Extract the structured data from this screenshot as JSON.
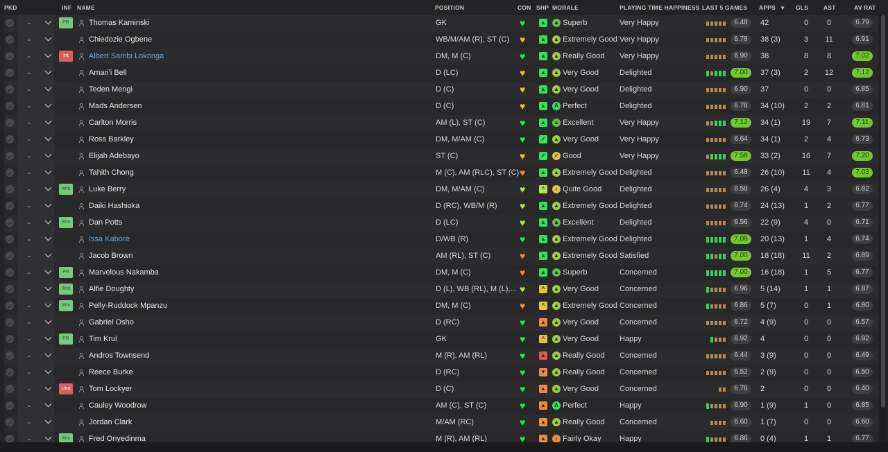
{
  "header": {
    "pkd": "PKD",
    "inf": "INF",
    "name": "NAME",
    "position": "POSITION",
    "con": "CON",
    "shp": "SHP",
    "morale": "MORALE",
    "playing_time_happiness": "PLAYING TIME HAPPINESS",
    "last5": "LAST 5 GAMES",
    "apps": "APPS",
    "apps_sort": "▾",
    "gls": "GLS",
    "ast": "AST",
    "avrat": "AV RAT"
  },
  "colors": {
    "green": "#2ce55b",
    "lime": "#b0e54a",
    "amber": "#e8c13c",
    "orange": "#f08b3b",
    "red": "#e05656",
    "form_green": "#32d45e",
    "form_olive": "#c8b25a",
    "form_tan": "#b58c55"
  },
  "players": [
    {
      "sel": "-",
      "inf": "PR",
      "name": "Thomas Kaminski",
      "link": false,
      "pos": "GK",
      "con": "#2ce55b",
      "shp": "green",
      "shp_sym": "▲",
      "mor_sym": "▲",
      "mor_col": "#5fc04a",
      "morale": "Superb",
      "pth": "Very Happy",
      "form": [
        "t",
        "t",
        "t",
        "t",
        "t"
      ],
      "last": "6.48",
      "last_hi": false,
      "apps": "42",
      "gls": "0",
      "ast": "0",
      "av": "6.79",
      "av_hi": false
    },
    {
      "sel": "-",
      "inf": "",
      "name": "Chiedozie Ogbene",
      "link": false,
      "pos": "WB/M/AM (R), ST (C)",
      "con": "#e8c13c",
      "shp": "green",
      "shp_sym": "▲",
      "mor_sym": "▲",
      "mor_col": "#9ccf3b",
      "morale": "Extremely Good",
      "pth": "Very Happy",
      "form": [
        "t",
        "t",
        "t",
        "t",
        "t"
      ],
      "last": "6.78",
      "last_hi": false,
      "apps": "38 (3)",
      "gls": "3",
      "ast": "11",
      "av": "6.91",
      "av_hi": false
    },
    {
      "sel": "-",
      "inf": "Int",
      "name": "Albert Sambi Lokonga",
      "link": true,
      "pos": "DM, M (C)",
      "con": "#2ce55b",
      "shp": "green",
      "shp_sym": "▲",
      "mor_sym": "▲",
      "mor_col": "#9ccf3b",
      "morale": "Really Good",
      "pth": "Very Happy",
      "form": [
        "t",
        "t",
        "t",
        "t",
        "t"
      ],
      "last": "6.90",
      "last_hi": false,
      "apps": "38",
      "gls": "8",
      "ast": "8",
      "av": "7.02",
      "av_hi": true
    },
    {
      "sel": "-",
      "inf": "",
      "name": "Amari'i Bell",
      "link": false,
      "pos": "D (LC)",
      "con": "#e8c13c",
      "shp": "green",
      "shp_sym": "▲",
      "mor_sym": "▲",
      "mor_col": "#9ccf3b",
      "morale": "Very Good",
      "pth": "Delighted",
      "form": [
        "g",
        "t",
        "g",
        "g",
        "g"
      ],
      "last": "7.00",
      "last_hi": true,
      "apps": "37 (3)",
      "gls": "2",
      "ast": "12",
      "av": "7.12",
      "av_hi": true
    },
    {
      "sel": "-",
      "inf": "",
      "name": "Teden Mengi",
      "link": false,
      "pos": "D (C)",
      "con": "#e8c13c",
      "shp": "green",
      "shp_sym": "▲",
      "mor_sym": "▲",
      "mor_col": "#9ccf3b",
      "morale": "Very Good",
      "pth": "Delighted",
      "form": [
        "t",
        "t",
        "t",
        "t",
        "t"
      ],
      "last": "6.90",
      "last_hi": false,
      "apps": "37",
      "gls": "0",
      "ast": "0",
      "av": "6.85",
      "av_hi": false
    },
    {
      "sel": "-",
      "inf": "",
      "name": "Mads Andersen",
      "link": false,
      "pos": "D (C)",
      "con": "#e8c13c",
      "shp": "green",
      "shp_sym": "▲",
      "mor_sym": "A",
      "mor_col": "#2ce55b",
      "morale": "Perfect",
      "pth": "Delighted",
      "form": [
        "t",
        "t",
        "t",
        "t",
        "t"
      ],
      "last": "6.78",
      "last_hi": false,
      "apps": "34 (10)",
      "gls": "2",
      "ast": "2",
      "av": "6.81",
      "av_hi": false
    },
    {
      "sel": "-",
      "inf": "",
      "name": "Carlton Morris",
      "link": false,
      "pos": "AM (L), ST (C)",
      "con": "#2ce55b",
      "shp": "green",
      "shp_sym": "▲",
      "mor_sym": "▲",
      "mor_col": "#5fc04a",
      "morale": "Excellent",
      "pth": "Very Happy",
      "form": [
        "t",
        "t",
        "g",
        "g",
        "g"
      ],
      "last": "7.12",
      "last_hi": true,
      "apps": "34 (1)",
      "gls": "19",
      "ast": "7",
      "av": "7.11",
      "av_hi": true
    },
    {
      "sel": "-",
      "inf": "",
      "name": "Ross Barkley",
      "link": false,
      "pos": "DM, M/AM (C)",
      "con": "#2ce55b",
      "shp": "green",
      "shp_sym": "✓",
      "mor_sym": "▲",
      "mor_col": "#9ccf3b",
      "morale": "Very Good",
      "pth": "Very Happy",
      "form": [
        "t",
        "t",
        "t",
        "t",
        "t"
      ],
      "last": "6.64",
      "last_hi": false,
      "apps": "34 (1)",
      "gls": "2",
      "ast": "4",
      "av": "6.73",
      "av_hi": false
    },
    {
      "sel": "-",
      "inf": "",
      "name": "Elijah Adebayo",
      "link": false,
      "pos": "ST (C)",
      "con": "#e8c13c",
      "shp": "green",
      "shp_sym": "✓",
      "mor_sym": "✓",
      "mor_col": "#e8c13c",
      "morale": "Good",
      "pth": "Very Happy",
      "form": [
        "t",
        "g",
        "g",
        "g",
        "g"
      ],
      "last": "7.58",
      "last_hi": true,
      "apps": "33 (2)",
      "gls": "16",
      "ast": "7",
      "av": "7.20",
      "av_hi": true
    },
    {
      "sel": "-",
      "inf": "",
      "name": "Tahith Chong",
      "link": false,
      "pos": "M (C), AM (RLC), ST (C)",
      "con": "#f08b3b",
      "shp": "green",
      "shp_sym": "▲",
      "mor_sym": "▲",
      "mor_col": "#9ccf3b",
      "morale": "Extremely Good",
      "pth": "Delighted",
      "form": [
        "t",
        "t",
        "t",
        "t",
        "t"
      ],
      "last": "6.48",
      "last_hi": false,
      "apps": "26 (10)",
      "gls": "11",
      "ast": "4",
      "av": "7.03",
      "av_hi": true
    },
    {
      "sel": "-",
      "inf": "Wnt",
      "name": "Luke Berry",
      "link": false,
      "pos": "DM, M/AM (C)",
      "con": "#b0e54a",
      "shp": "lime",
      "shp_sym": "^",
      "mor_sym": "›",
      "mor_col": "#e8c13c",
      "morale": "Quite Good",
      "pth": "Delighted",
      "form": [
        "t",
        "t",
        "t",
        "t",
        "t"
      ],
      "last": "6.56",
      "last_hi": false,
      "apps": "26 (4)",
      "gls": "4",
      "ast": "3",
      "av": "6.82",
      "av_hi": false
    },
    {
      "sel": "-",
      "inf": "",
      "name": "Daiki Hashioka",
      "link": false,
      "pos": "D (RC), WB/M (R)",
      "con": "#b0e54a",
      "shp": "green",
      "shp_sym": "▲",
      "mor_sym": "▲",
      "mor_col": "#9ccf3b",
      "morale": "Extremely Good",
      "pth": "Delighted",
      "form": [
        "t",
        "t",
        "t",
        "t",
        "t"
      ],
      "last": "6.74",
      "last_hi": false,
      "apps": "24 (13)",
      "gls": "1",
      "ast": "2",
      "av": "6.77",
      "av_hi": false
    },
    {
      "sel": "-",
      "inf": "Wnt",
      "name": "Dan Potts",
      "link": false,
      "pos": "D (LC)",
      "con": "#b0e54a",
      "shp": "green",
      "shp_sym": "▲",
      "mor_sym": "▲",
      "mor_col": "#5fc04a",
      "morale": "Excellent",
      "pth": "Delighted",
      "form": [
        "t",
        "t",
        "t",
        "t",
        "t"
      ],
      "last": "6.56",
      "last_hi": false,
      "apps": "22 (9)",
      "gls": "4",
      "ast": "0",
      "av": "6.71",
      "av_hi": false
    },
    {
      "sel": "-",
      "inf": "",
      "name": "Issa Kaboré",
      "link": true,
      "pos": "D/WB (R)",
      "con": "#2ce55b",
      "shp": "green",
      "shp_sym": "▲",
      "mor_sym": "▲",
      "mor_col": "#9ccf3b",
      "morale": "Extremely Good",
      "pth": "Delighted",
      "form": [
        "g",
        "g",
        "g",
        "g",
        "g"
      ],
      "last": "7.06",
      "last_hi": true,
      "apps": "20 (13)",
      "gls": "1",
      "ast": "4",
      "av": "6.74",
      "av_hi": false
    },
    {
      "sel": "-",
      "inf": "",
      "name": "Jacob Brown",
      "link": false,
      "pos": "AM (RL), ST (C)",
      "con": "#f08b3b",
      "shp": "green",
      "shp_sym": "▲",
      "mor_sym": "▲",
      "mor_col": "#9ccf3b",
      "morale": "Extremely Good",
      "pth": "Satisfied",
      "form": [
        "g",
        "g",
        "t",
        "g",
        "g"
      ],
      "last": "7.00",
      "last_hi": true,
      "apps": "18 (18)",
      "gls": "11",
      "ast": "2",
      "av": "6.89",
      "av_hi": false
    },
    {
      "sel": "-",
      "inf": "PR",
      "name": "Marvelous Nakamba",
      "link": false,
      "pos": "DM, M (C)",
      "con": "#f08b3b",
      "shp": "green",
      "shp_sym": "▲",
      "mor_sym": "▲",
      "mor_col": "#5fc04a",
      "morale": "Superb",
      "pth": "Concerned",
      "form": [
        "g",
        "g",
        "g",
        "g",
        "g"
      ],
      "last": "7.00",
      "last_hi": true,
      "apps": "16 (18)",
      "gls": "1",
      "ast": "5",
      "av": "6.77",
      "av_hi": false
    },
    {
      "sel": "-",
      "inf": "Wnt",
      "name": "Alfie Doughty",
      "link": false,
      "pos": "D (L), WB (RL), M (L),...",
      "con": "#b0e54a",
      "shp": "amber",
      "shp_sym": "^",
      "mor_sym": "▲",
      "mor_col": "#9ccf3b",
      "morale": "Very Good",
      "pth": "Concerned",
      "form": [
        "g",
        "t",
        "t",
        "t",
        "t"
      ],
      "last": "6.96",
      "last_hi": false,
      "apps": "5 (14)",
      "gls": "1",
      "ast": "1",
      "av": "6.87",
      "av_hi": false
    },
    {
      "sel": "-",
      "inf": "Wnt",
      "name": "Pelly-Ruddock Mpanzu",
      "link": false,
      "pos": "DM, M (C)",
      "con": "#f08b3b",
      "shp": "amber",
      "shp_sym": "^",
      "mor_sym": "▲",
      "mor_col": "#9ccf3b",
      "morale": "Extremely Good",
      "pth": "Concerned",
      "form": [
        "g",
        "t",
        "t",
        "t",
        "t"
      ],
      "last": "6.86",
      "last_hi": false,
      "apps": "5 (7)",
      "gls": "0",
      "ast": "1",
      "av": "6.80",
      "av_hi": false
    },
    {
      "sel": "-",
      "inf": "",
      "name": "Gabriel Osho",
      "link": false,
      "pos": "D (RC)",
      "con": "#2ce55b",
      "shp": "orange",
      "shp_sym": "▲",
      "mor_sym": "▲",
      "mor_col": "#9ccf3b",
      "morale": "Very Good",
      "pth": "Concerned",
      "form": [
        "t",
        "t",
        "t",
        "t",
        "t"
      ],
      "last": "6.72",
      "last_hi": false,
      "apps": "4 (9)",
      "gls": "0",
      "ast": "0",
      "av": "6.57",
      "av_hi": false
    },
    {
      "sel": "-",
      "inf": "PR",
      "name": "Tim Krul",
      "link": false,
      "pos": "GK",
      "con": "#2ce55b",
      "shp": "amber",
      "shp_sym": "^",
      "mor_sym": "▲",
      "mor_col": "#9ccf3b",
      "morale": "Very Good",
      "pth": "Happy",
      "form": [
        "g",
        "t",
        "t",
        "t"
      ],
      "last": "6.92",
      "last_hi": false,
      "apps": "4",
      "gls": "0",
      "ast": "0",
      "av": "6.92",
      "av_hi": false
    },
    {
      "sel": "-",
      "inf": "",
      "name": "Andros Townsend",
      "link": false,
      "pos": "M (R), AM (RL)",
      "con": "#2ce55b",
      "shp": "red",
      "shp_sym": "▲",
      "mor_sym": "▲",
      "mor_col": "#9ccf3b",
      "morale": "Really Good",
      "pth": "Concerned",
      "form": [
        "t",
        "t",
        "t",
        "t",
        "t"
      ],
      "last": "6.44",
      "last_hi": false,
      "apps": "3 (9)",
      "gls": "0",
      "ast": "0",
      "av": "6.49",
      "av_hi": false
    },
    {
      "sel": "-",
      "inf": "",
      "name": "Reece Burke",
      "link": false,
      "pos": "D (RC)",
      "con": "#2ce55b",
      "shp": "orange",
      "shp_sym": "▼",
      "mor_sym": "▲",
      "mor_col": "#9ccf3b",
      "morale": "Really Good",
      "pth": "Concerned",
      "form": [
        "t",
        "t",
        "t",
        "t",
        "t"
      ],
      "last": "6.52",
      "last_hi": false,
      "apps": "2 (9)",
      "gls": "0",
      "ast": "0",
      "av": "6.50",
      "av_hi": false
    },
    {
      "sel": "-",
      "inf": "Una",
      "name": "Tom Lockyer",
      "link": false,
      "pos": "D (C)",
      "con": "#2ce55b",
      "shp": "orange",
      "shp_sym": "▲",
      "mor_sym": "▲",
      "mor_col": "#9ccf3b",
      "morale": "Very Good",
      "pth": "Concerned",
      "form": [
        "t",
        "t"
      ],
      "last": "6.76",
      "last_hi": false,
      "apps": "2",
      "gls": "0",
      "ast": "0",
      "av": "6.40",
      "av_hi": false
    },
    {
      "sel": "-",
      "inf": "",
      "name": "Cauley Woodrow",
      "link": false,
      "pos": "AM (C), ST (C)",
      "con": "#2ce55b",
      "shp": "orange",
      "shp_sym": "▲",
      "mor_sym": "A",
      "mor_col": "#2ce55b",
      "morale": "Perfect",
      "pth": "Happy",
      "form": [
        "g",
        "t",
        "t",
        "t",
        "t"
      ],
      "last": "6.90",
      "last_hi": false,
      "apps": "1 (9)",
      "gls": "1",
      "ast": "0",
      "av": "6.85",
      "av_hi": false
    },
    {
      "sel": "-",
      "inf": "",
      "name": "Jordan Clark",
      "link": false,
      "pos": "M/AM (RC)",
      "con": "#2ce55b",
      "shp": "orange",
      "shp_sym": "▲",
      "mor_sym": "▲",
      "mor_col": "#9ccf3b",
      "morale": "Really Good",
      "pth": "Concerned",
      "form": [
        "t",
        "t",
        "t",
        "t"
      ],
      "last": "6.60",
      "last_hi": false,
      "apps": "1 (7)",
      "gls": "0",
      "ast": "0",
      "av": "6.60",
      "av_hi": false
    },
    {
      "sel": "-",
      "inf": "Wnt",
      "name": "Fred Onyedinma",
      "link": false,
      "pos": "M (R), AM (RL)",
      "con": "#2ce55b",
      "shp": "orange",
      "shp_sym": "▲",
      "mor_sym": "›",
      "mor_col": "#f08b3b",
      "morale": "Fairly Okay",
      "pth": "Happy",
      "form": [
        "g",
        "t",
        "t",
        "t",
        "t"
      ],
      "last": "6.86",
      "last_hi": false,
      "apps": "0 (4)",
      "gls": "1",
      "ast": "1",
      "av": "6.77",
      "av_hi": false
    }
  ]
}
